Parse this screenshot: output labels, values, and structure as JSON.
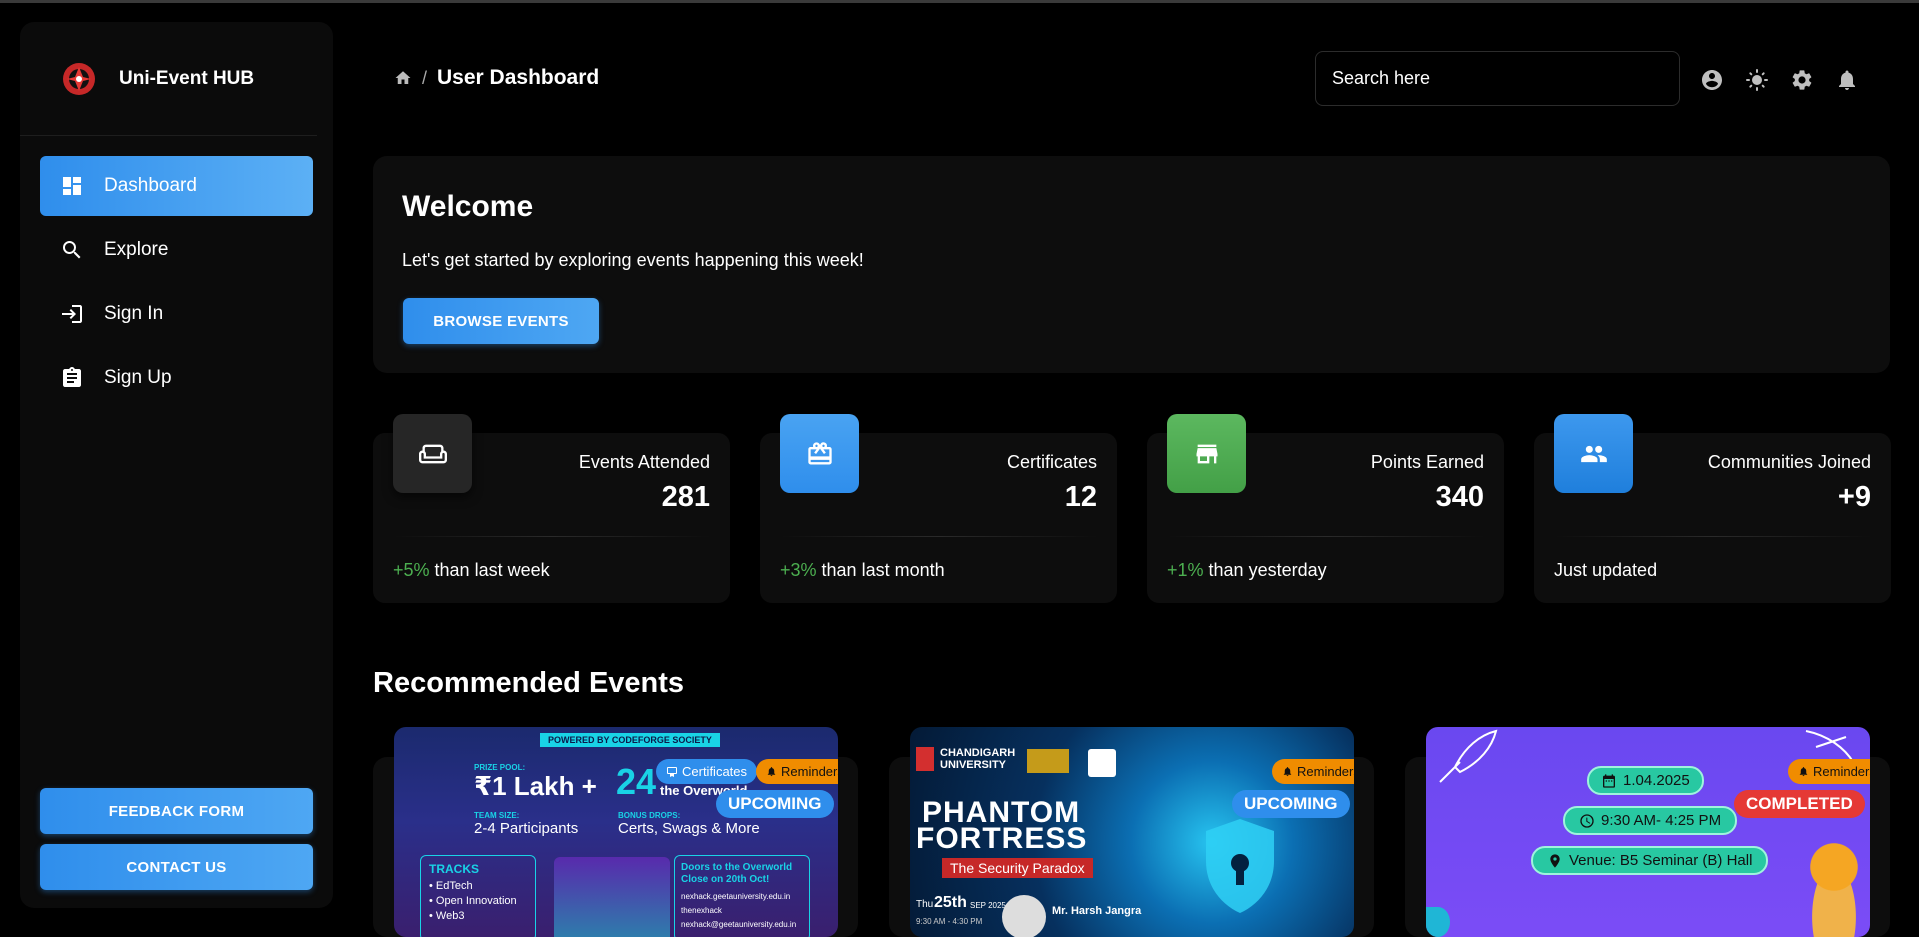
{
  "brand": {
    "name": "Uni-Event HUB"
  },
  "sidebar": {
    "items": [
      {
        "label": "Dashboard",
        "icon": "dashboard-icon",
        "active": true
      },
      {
        "label": "Explore",
        "icon": "search-icon",
        "active": false
      },
      {
        "label": "Sign In",
        "icon": "sign-in-icon",
        "active": false
      },
      {
        "label": "Sign Up",
        "icon": "clipboard-icon",
        "active": false
      }
    ],
    "feedback_label": "FEEDBACK FORM",
    "contact_label": "CONTACT US"
  },
  "header": {
    "breadcrumb_title": "User Dashboard",
    "search_placeholder": "Search here"
  },
  "welcome": {
    "title": "Welcome",
    "text": "Let's get started by exploring events happening this week!",
    "button_label": "BROWSE EVENTS"
  },
  "stats": [
    {
      "label": "Events Attended",
      "value": "281",
      "pct": "+5%",
      "foot": " than last week",
      "icon": "sofa-icon",
      "color": "#262626"
    },
    {
      "label": "Certificates",
      "value": "12",
      "pct": "+3%",
      "foot": " than last month",
      "icon": "gift-card-icon",
      "color": "#3c99ef"
    },
    {
      "label": "Points Earned",
      "value": "340",
      "pct": "+1%",
      "foot": " than yesterday",
      "icon": "store-icon",
      "color": "#4caf50"
    },
    {
      "label": "Communities Joined",
      "value": "+9",
      "pct": "",
      "foot": "Just updated",
      "icon": "people-icon",
      "color": "#2f8eec"
    }
  ],
  "recommended": {
    "title": "Recommended Events",
    "events": [
      {
        "status": "UPCOMING",
        "certificates_label": "Certificates",
        "reminder_label": "Reminders",
        "poster": {
          "powered": "POWERED BY CODEFORGE SOCIETY",
          "prize_label": "PRIZE POOL:",
          "prize": "₹1 Lakh +",
          "hours": "24",
          "hours_text": "the Overworld",
          "team_label": "TEAM SIZE:",
          "team": "2-4 Participants",
          "bonus_label": "BONUS DROPS:",
          "bonus": "Certs, Swags & More",
          "tracks_title": "TRACKS",
          "tracks": [
            "EdTech",
            "Open Innovation",
            "Web3"
          ],
          "doors": "Doors to the Overworld Close on 20th Oct!",
          "contacts": [
            "nexhack.geetauniversity.edu.in",
            "thenexhack",
            "nexhack@geetauniversity.edu.in"
          ]
        }
      },
      {
        "status": "UPCOMING",
        "reminder_label": "Reminders",
        "poster": {
          "uni": "CHANDIGARH UNIVERSITY",
          "title1": "PHANTOM",
          "title2": "FORTRESS",
          "subtitle": "The Security Paradox",
          "day": "Thu",
          "date": "25th",
          "month": "SEP 2025",
          "time": "9:30 AM - 4:30 PM",
          "speaker": "Mr. Harsh Jangra"
        }
      },
      {
        "status": "COMPLETED",
        "reminder_label": "Reminders",
        "poster": {
          "date": "1.04.2025",
          "time": "9:30 AM- 4:25 PM",
          "venue": "Venue:  B5 Seminar (B) Hall"
        }
      }
    ]
  }
}
